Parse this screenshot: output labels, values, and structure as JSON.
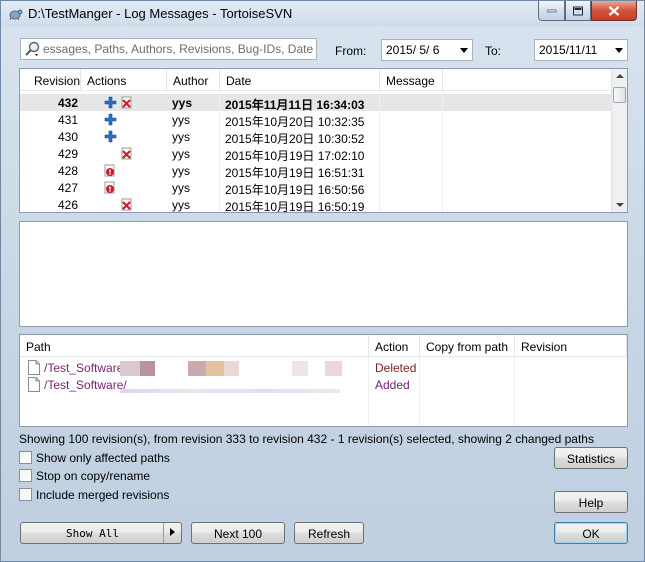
{
  "window": {
    "title": "D:\\TestManger - Log Messages - TortoiseSVN"
  },
  "filter": {
    "search_placeholder": "essages, Paths, Authors, Revisions, Bug-IDs, Date,",
    "from_label": "From:",
    "from_value": "2015/  5/  6",
    "to_label": "To:",
    "to_value": "2015/11/11"
  },
  "revisions": {
    "columns": [
      "Revision",
      "Actions",
      "Author",
      "Date",
      "Message"
    ],
    "rows": [
      {
        "rev": "432",
        "actions": [
          "added",
          "deleted"
        ],
        "author": "yys",
        "date": "2015年11月11日 16:34:03",
        "selected": true
      },
      {
        "rev": "431",
        "actions": [
          "added"
        ],
        "author": "yys",
        "date": "2015年10月20日 10:32:35",
        "selected": false
      },
      {
        "rev": "430",
        "actions": [
          "added"
        ],
        "author": "yys",
        "date": "2015年10月20日 10:30:52",
        "selected": false
      },
      {
        "rev": "429",
        "actions": [
          "none",
          "deleted"
        ],
        "author": "yys",
        "date": "2015年10月19日 17:02:10",
        "selected": false
      },
      {
        "rev": "428",
        "actions": [
          "modified"
        ],
        "author": "yys",
        "date": "2015年10月19日 16:51:31",
        "selected": false
      },
      {
        "rev": "427",
        "actions": [
          "modified"
        ],
        "author": "yys",
        "date": "2015年10月19日 16:50:56",
        "selected": false
      },
      {
        "rev": "426",
        "actions": [
          "none",
          "deleted"
        ],
        "author": "yys",
        "date": "2015年10月19日 16:50:19",
        "selected": false
      }
    ]
  },
  "paths": {
    "columns": [
      "Path",
      "Action",
      "Copy from path",
      "Revision"
    ],
    "rows": [
      {
        "path": "/Test_Software/",
        "action": "Deleted"
      },
      {
        "path": "/Test_Software/",
        "action": "Added"
      }
    ]
  },
  "status_text": "Showing 100 revision(s), from revision 333 to revision 432 - 1 revision(s) selected, showing 2 changed paths",
  "options": {
    "show_only_affected": "Show only affected paths",
    "stop_on_copy": "Stop on copy/rename",
    "include_merged": "Include merged revisions"
  },
  "buttons": {
    "statistics": "Statistics",
    "help": "Help",
    "show_all": "Show  All",
    "next_100": "Next 100",
    "refresh": "Refresh",
    "ok": "OK"
  },
  "colors": {
    "added_icon": "#2a6fc9",
    "deleted_icon": "#c8202a",
    "modified_icon": "#c8202a",
    "path_text": "#7a1f73"
  }
}
